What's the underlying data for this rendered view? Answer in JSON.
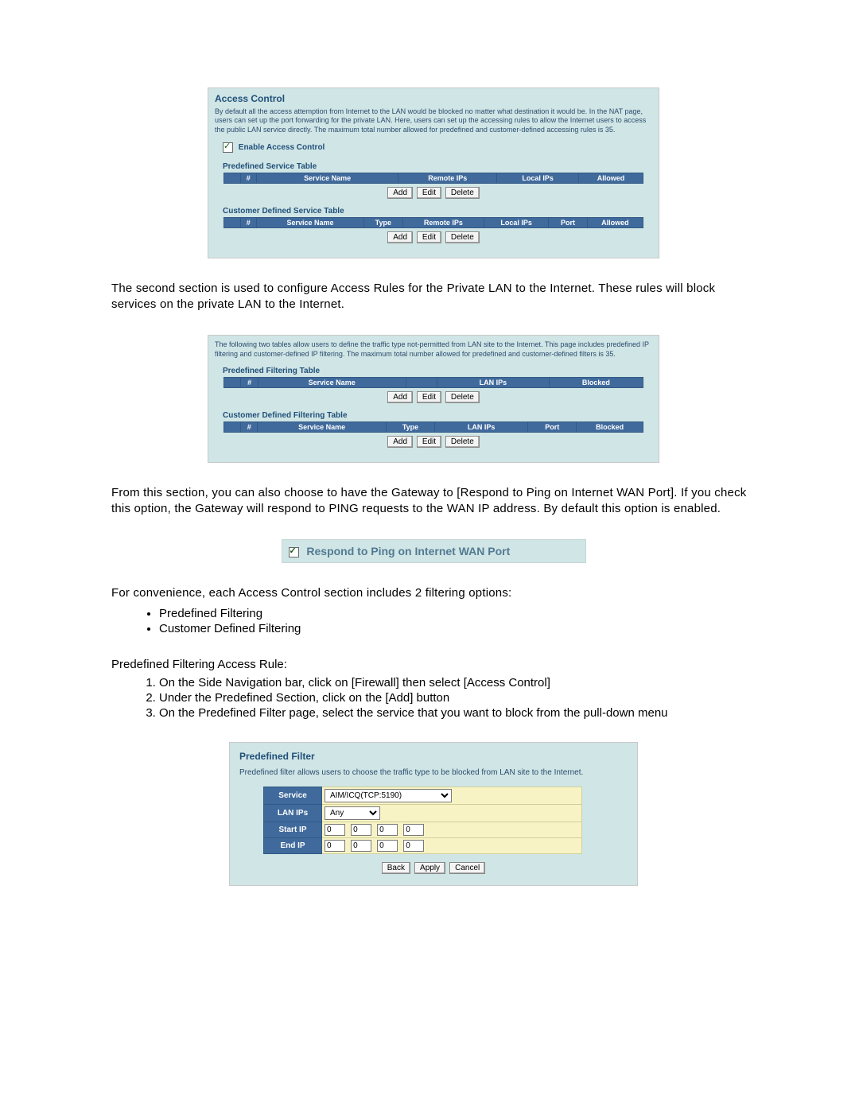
{
  "panel1": {
    "title": "Access Control",
    "desc": "By default all the access attemption from Internet to the LAN would be blocked no matter what destination it would be. In the NAT page, users can set up the port forwarding for the private LAN. Here, users can set up the accessing rules to allow the Internet users to access the public LAN service directly. The maximum total number allowed for predefined and customer-defined accessing rules is 35.",
    "enable_label": "Enable Access Control",
    "pre_label": "Predefined Service Table",
    "pre_cols": {
      "a": " ",
      "b": "#",
      "c": "Service Name",
      "d": "Remote IPs",
      "e": "Local IPs",
      "f": "Allowed"
    },
    "cust_label": "Customer Defined Service Table",
    "cust_cols": {
      "a": " ",
      "b": "#",
      "c": "Service Name",
      "d": "Type",
      "e": "Remote IPs",
      "f": "Local IPs",
      "g": "Port",
      "h": "Allowed"
    },
    "btn_add": "Add",
    "btn_edit": "Edit",
    "btn_del": "Delete"
  },
  "para1": "The second section is used to configure Access Rules for the Private LAN to the Internet.   These rules will block services on the private LAN to the Internet.",
  "panel2": {
    "desc": "The following two tables allow users to define the traffic type not-permitted from LAN site to the Internet. This page includes predefined IP filtering and customer-defined IP filtering. The maximum total number allowed for predefined and customer-defined filters is 35.",
    "pre_label": "Predefined Filtering Table",
    "pre_cols": {
      "a": " ",
      "b": "#",
      "c": "Service Name",
      "c2": " ",
      "d": "LAN IPs",
      "e": "Blocked"
    },
    "cust_label": "Customer Defined Filtering Table",
    "cust_cols": {
      "a": " ",
      "b": "#",
      "c": "Service Name",
      "d": "Type",
      "e": "LAN IPs",
      "f": "Port",
      "g": "Blocked"
    },
    "btn_add": "Add",
    "btn_edit": "Edit",
    "btn_del": "Delete"
  },
  "para2": "From this section, you can also choose to have the Gateway to [Respond to Ping on Internet WAN Port].   If you check this option, the Gateway will respond to PING requests to the WAN IP address.   By default this option is enabled.",
  "ping_label": "Respond to Ping on Internet WAN Port",
  "para3": "For convenience, each Access Control section includes 2 filtering options:",
  "bullets": {
    "0": "Predefined Filtering",
    "1": "Customer Defined Filtering"
  },
  "heading_rule": "Predefined Filtering Access Rule:",
  "steps": {
    "0": "On the Side Navigation bar, click on [Firewall] then select [Access Control]",
    "1": "Under the Predefined Section, click on the [Add] button",
    "2": "On the Predefined Filter page, select the service that you want to block from the pull-down menu"
  },
  "filter": {
    "title": "Predefined Filter",
    "desc": "Predefined filter allows users to choose the traffic type to be blocked from LAN site to the Internet.",
    "lab_service": "Service",
    "lab_lan": "LAN IPs",
    "lab_start": "Start IP",
    "lab_end": "End IP",
    "service_value": "AIM/ICQ(TCP:5190)",
    "lan_value": "Any",
    "oct": "0",
    "btn_back": "Back",
    "btn_apply": "Apply",
    "btn_cancel": "Cancel"
  }
}
